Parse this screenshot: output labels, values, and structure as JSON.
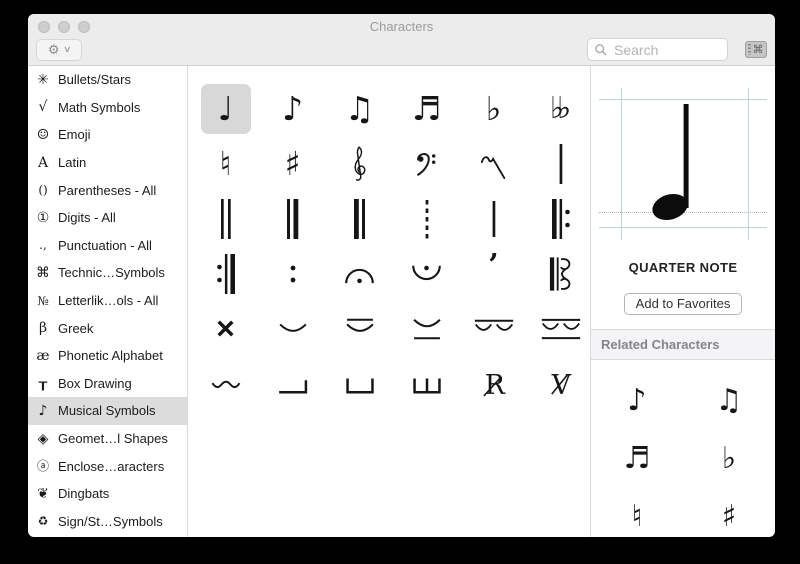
{
  "window": {
    "title": "Characters"
  },
  "toolbar": {
    "action_button": {
      "icon": "gear-icon",
      "glyph": "⚙",
      "chevron_icon": "chevron-down-icon",
      "chevron_glyph": "∨"
    },
    "search": {
      "icon": "search-icon",
      "placeholder": "Search",
      "value": ""
    },
    "keyboard_button": {
      "icon": "keyboard-command-icon",
      "glyph": "⌘"
    }
  },
  "sidebar": {
    "items": [
      {
        "icon": "bullets-stars-icon",
        "icon_glyph": "✳",
        "label": "Bullets/Stars",
        "selected": false
      },
      {
        "icon": "square-root-icon",
        "icon_glyph": "√",
        "label": "Math Symbols",
        "selected": false
      },
      {
        "icon": "smiley-icon",
        "icon_glyph": "☺",
        "label": "Emoji",
        "selected": false
      },
      {
        "icon": "letter-a-icon",
        "icon_glyph": "A",
        "label": "Latin",
        "selected": false
      },
      {
        "icon": "parentheses-icon",
        "icon_glyph": "()",
        "label": "Parentheses - All",
        "selected": false
      },
      {
        "icon": "circled-one-icon",
        "icon_glyph": "①",
        "label": "Digits - All",
        "selected": false
      },
      {
        "icon": "period-comma-icon",
        "icon_glyph": ".,",
        "label": "Punctuation - All",
        "selected": false
      },
      {
        "icon": "command-icon",
        "icon_glyph": "⌘",
        "label": "Technic…Symbols",
        "selected": false
      },
      {
        "icon": "numero-icon",
        "icon_glyph": "№",
        "label": "Letterlik…ols - All",
        "selected": false
      },
      {
        "icon": "beta-icon",
        "icon_glyph": "β",
        "label": "Greek",
        "selected": false
      },
      {
        "icon": "ae-ligature-icon",
        "icon_glyph": "æ",
        "label": "Phonetic Alphabet",
        "selected": false
      },
      {
        "icon": "box-drawing-icon",
        "icon_glyph": "┰",
        "label": "Box Drawing",
        "selected": false
      },
      {
        "icon": "eighth-note-icon",
        "icon_glyph": "♪",
        "label": "Musical Symbols",
        "selected": true
      },
      {
        "icon": "diamond-icon",
        "icon_glyph": "◈",
        "label": "Geomet…l Shapes",
        "selected": false
      },
      {
        "icon": "circled-a-icon",
        "icon_glyph": "ⓐ",
        "label": "Enclose…aracters",
        "selected": false
      },
      {
        "icon": "floral-heart-icon",
        "icon_glyph": "❦",
        "label": "Dingbats",
        "selected": false
      },
      {
        "icon": "recycling-icon",
        "icon_glyph": "♻",
        "label": "Sign/St…Symbols",
        "selected": false
      }
    ]
  },
  "grid": {
    "cells": [
      {
        "name": "quarter-note",
        "type": "text",
        "glyph": "♩",
        "selected": true
      },
      {
        "name": "eighth-note",
        "type": "text",
        "glyph": "♪",
        "selected": false
      },
      {
        "name": "beamed-eighth-notes",
        "type": "text",
        "glyph": "♫",
        "selected": false
      },
      {
        "name": "beamed-sixteenth-notes",
        "type": "text",
        "glyph": "♬",
        "selected": false
      },
      {
        "name": "music-flat-sign",
        "type": "text",
        "glyph": "♭",
        "selected": false
      },
      {
        "name": "music-double-flat-sign",
        "type": "text",
        "glyph": "♭♭",
        "selected": false,
        "tight": true
      },
      {
        "name": "music-natural-sign",
        "type": "text",
        "glyph": "♮",
        "selected": false
      },
      {
        "name": "music-sharp-sign",
        "type": "text",
        "glyph": "♯",
        "selected": false
      },
      {
        "name": "treble-clef",
        "type": "svg",
        "glyph": "treble-clef",
        "selected": false
      },
      {
        "name": "bass-clef",
        "type": "svg",
        "glyph": "bass-clef",
        "selected": false
      },
      {
        "name": "ornament-stroke",
        "type": "svg",
        "glyph": "squiggle",
        "selected": false
      },
      {
        "name": "single-barline",
        "type": "svg",
        "glyph": "barline-single",
        "selected": false
      },
      {
        "name": "double-barline",
        "type": "svg",
        "glyph": "barline-double",
        "selected": false
      },
      {
        "name": "final-barline",
        "type": "svg",
        "glyph": "barline-final",
        "selected": false
      },
      {
        "name": "reverse-final-barline",
        "type": "svg",
        "glyph": "barline-reverse-final",
        "selected": false
      },
      {
        "name": "dashed-barline",
        "type": "svg",
        "glyph": "barline-dashed",
        "selected": false
      },
      {
        "name": "short-barline",
        "type": "svg",
        "glyph": "barline-short",
        "selected": false
      },
      {
        "name": "left-repeat-sign",
        "type": "svg",
        "glyph": "repeat-left",
        "selected": false
      },
      {
        "name": "right-repeat-sign",
        "type": "svg",
        "glyph": "repeat-right",
        "selected": false
      },
      {
        "name": "repeat-dots",
        "type": "svg",
        "glyph": "repeat-dots",
        "selected": false
      },
      {
        "name": "fermata",
        "type": "svg",
        "glyph": "fermata",
        "selected": false
      },
      {
        "name": "fermata-below",
        "type": "svg",
        "glyph": "fermata-below",
        "selected": false
      },
      {
        "name": "breath-mark",
        "type": "text",
        "glyph": "’",
        "selected": false,
        "serif": true
      },
      {
        "name": "alto-clef",
        "type": "svg",
        "glyph": "alto-clef",
        "selected": false
      },
      {
        "name": "double-sharp-sign",
        "type": "svg",
        "glyph": "double-sharp",
        "selected": false
      },
      {
        "name": "metrical-breve",
        "type": "svg",
        "glyph": "cup",
        "selected": false
      },
      {
        "name": "metrical-long-over-short",
        "type": "svg",
        "glyph": "cup-line-above",
        "selected": false
      },
      {
        "name": "metrical-short-over-long",
        "type": "svg",
        "glyph": "cup-line-below",
        "selected": false
      },
      {
        "name": "metrical-two-shorts-over-long",
        "type": "svg",
        "glyph": "two-cups-line-above",
        "selected": false
      },
      {
        "name": "metrical-two-shorts-joined",
        "type": "svg",
        "glyph": "two-cups-two-lines",
        "selected": false
      },
      {
        "name": "metrical-triseme",
        "type": "svg",
        "glyph": "wave",
        "selected": false
      },
      {
        "name": "metrical-tetraseme",
        "type": "svg",
        "glyph": "corner-right",
        "selected": false
      },
      {
        "name": "metrical-pentaseme",
        "type": "svg",
        "glyph": "open-box",
        "selected": false
      },
      {
        "name": "metrical-hexaseme",
        "type": "svg",
        "glyph": "open-box-mid",
        "selected": false
      },
      {
        "name": "response-symbol",
        "type": "svg",
        "glyph": "response",
        "selected": false
      },
      {
        "name": "versicle-symbol",
        "type": "svg",
        "glyph": "versicle",
        "selected": false
      }
    ]
  },
  "detail": {
    "preview_glyph": "quarter-note",
    "character_name": "QUARTER NOTE",
    "favorites_label": "Add to Favorites",
    "related_header": "Related Characters",
    "related": [
      {
        "name": "eighth-note",
        "glyph": "♪"
      },
      {
        "name": "beamed-eighth-notes",
        "glyph": "♫"
      },
      {
        "name": "beamed-sixteenth-notes",
        "glyph": "♬"
      },
      {
        "name": "music-flat-sign",
        "glyph": "♭"
      },
      {
        "name": "music-natural-sign",
        "glyph": "♮"
      },
      {
        "name": "music-sharp-sign",
        "glyph": "♯"
      }
    ]
  },
  "colors": {
    "chrome_bg": "#ececec",
    "cell_selection": "#d8d8d8",
    "sidebar_selection": "#dcdcdc",
    "guide_blue": "#b9d3ea",
    "divider": "#d9d9d9",
    "related_header_bg": "#f4f4f6",
    "related_header_text": "#84848a",
    "title_text": "#9b9b9b"
  }
}
